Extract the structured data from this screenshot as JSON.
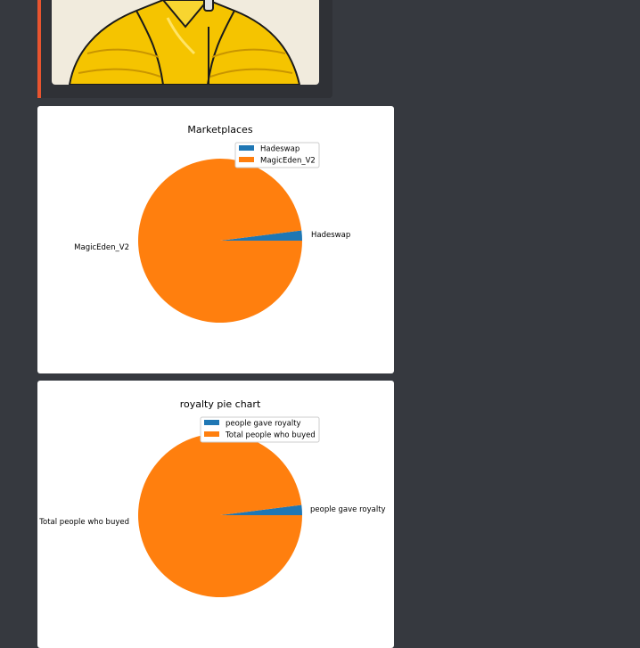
{
  "colors": {
    "background": "#36393f",
    "embed_accent": "#e8542f",
    "slice_blue": "#1f77b4",
    "slice_orange": "#ff7f0e"
  },
  "embed": {
    "thumbnail_icon": "yellow-puffer-jacket-image"
  },
  "chart_data": [
    {
      "type": "pie",
      "title": "Marketplaces",
      "labels": [
        "Hadeswap",
        "MagicEden_V2"
      ],
      "values": [
        2,
        98
      ],
      "colors": [
        "#1f77b4",
        "#ff7f0e"
      ],
      "legend": "upper-right"
    },
    {
      "type": "pie",
      "title": "royalty pie chart",
      "labels": [
        "people gave royalty",
        "Total people who buyed"
      ],
      "values": [
        2,
        98
      ],
      "colors": [
        "#1f77b4",
        "#ff7f0e"
      ],
      "legend": "upper-right"
    }
  ]
}
